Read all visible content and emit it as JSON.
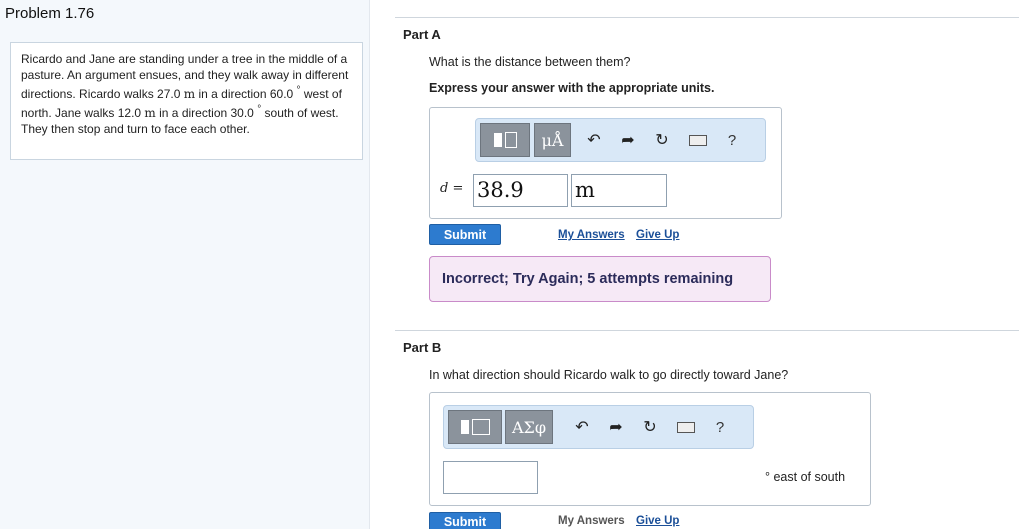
{
  "problem": {
    "title": "Problem 1.76",
    "text_parts": [
      "Ricardo and Jane are standing under a tree in the middle of a pasture. An argument ensues, and they walk away in different directions. Ricardo walks 27.0 ",
      "m",
      " in a direction 60.0 ",
      "°",
      " west of north. Jane walks 12.0 ",
      "m",
      " in a direction 30.0 ",
      "°",
      " south of west. They then stop and turn to face each other."
    ]
  },
  "partA": {
    "title": "Part A",
    "question": "What is the distance between them?",
    "instruction": "Express your answer with the appropriate units.",
    "toolbar": {
      "units_button": "μÅ",
      "help": "?"
    },
    "variable_label": "d =",
    "value": "38.9",
    "unit": "m",
    "submit_label": "Submit",
    "my_answers_label": "My Answers",
    "give_up_label": "Give Up",
    "feedback": "Incorrect; Try Again; 5 attempts remaining"
  },
  "partB": {
    "title": "Part B",
    "question": "In what direction should Ricardo walk to go directly toward Jane?",
    "toolbar": {
      "symbols_button": "ΑΣφ",
      "help": "?"
    },
    "value": "",
    "unit_text": "° east of south",
    "submit_label": "Submit",
    "my_answers_label": "My Answers",
    "give_up_label": "Give Up"
  },
  "icons": {
    "undo": "undo-icon",
    "redo": "redo-icon",
    "reset": "reset-icon",
    "keyboard": "keyboard-icon",
    "help": "help-icon"
  }
}
